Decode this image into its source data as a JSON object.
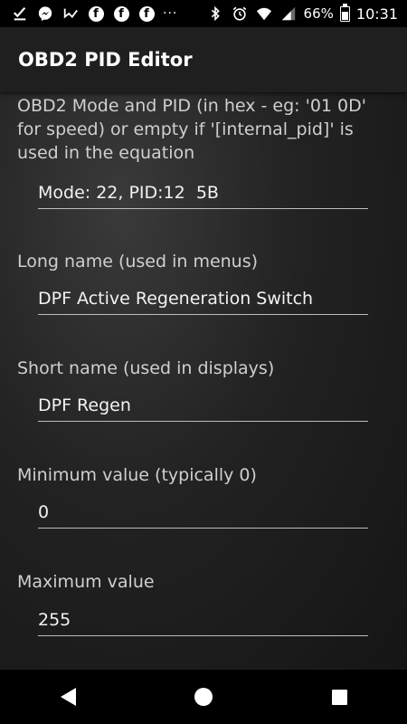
{
  "status_bar": {
    "icons": [
      "download-done-icon",
      "messenger-icon",
      "check-mark-icon",
      "facebook-icon",
      "facebook-icon",
      "facebook-icon",
      "more-notifications-icon"
    ],
    "facebook_letter": "f",
    "more": "···",
    "battery": "66%",
    "time": "10:31"
  },
  "app_bar": {
    "title": "OBD2 PID Editor"
  },
  "form": {
    "mode_pid": {
      "label": "OBD2 Mode and PID (in hex - eg: '01 0D' for speed) or empty if '[internal_pid]' is used in the equation",
      "value": "Mode: 22, PID:12  5B"
    },
    "long_name": {
      "label": "Long name (used in menus)",
      "value": "DPF Active Regeneration Switch"
    },
    "short_name": {
      "label": "Short name (used in displays)",
      "value": "DPF Regen"
    },
    "min_value": {
      "label": "Minimum value (typically 0)",
      "value": "0"
    },
    "max_value": {
      "label": "Maximum value",
      "value": "255"
    }
  },
  "nav_bar": {
    "buttons": [
      "back",
      "home",
      "recent-apps"
    ]
  }
}
